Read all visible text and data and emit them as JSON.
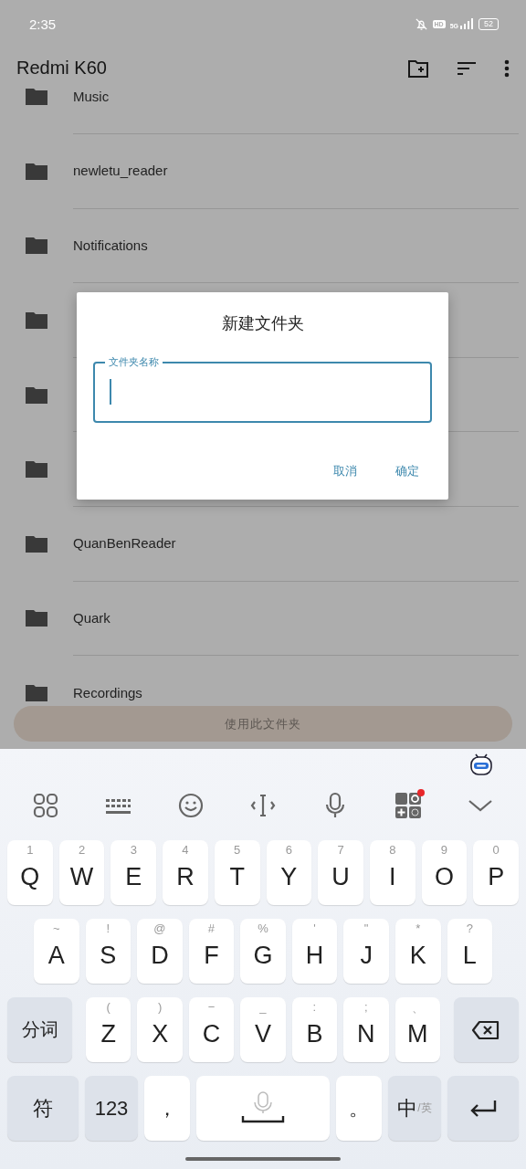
{
  "status_bar": {
    "time": "2:35",
    "muted": true,
    "hd": "HD",
    "network": "5G",
    "battery": "52"
  },
  "app_bar": {
    "title": "Redmi K60",
    "actions": [
      {
        "kind": "new-folder"
      },
      {
        "kind": "sort"
      },
      {
        "kind": "more"
      }
    ]
  },
  "folders": [
    {
      "kind": "folder",
      "label": "Music"
    },
    {
      "kind": "folder",
      "label": "newletu_reader"
    },
    {
      "kind": "folder",
      "label": "Notifications"
    },
    {
      "kind": "covered"
    },
    {
      "kind": "covered"
    },
    {
      "kind": "covered"
    },
    {
      "kind": "folder",
      "label": "QuanBenReader"
    },
    {
      "kind": "folder",
      "label": "Quark"
    },
    {
      "kind": "folder",
      "label": "Recordings"
    }
  ],
  "use_folder_button": "使用此文件夹",
  "dialog": {
    "title": "新建文件夹",
    "field": {
      "label": "文件夹名称",
      "focused": true
    },
    "buttons": [
      "取消",
      "确定"
    ]
  },
  "keyboard": {
    "toolbar": [
      {
        "kind": "apps",
        "badge": false
      },
      {
        "kind": "keyboard",
        "badge": false
      },
      {
        "kind": "emoji",
        "badge": false
      },
      {
        "kind": "cursor",
        "badge": false
      },
      {
        "kind": "mic",
        "badge": false
      },
      {
        "kind": "tools",
        "badge": true
      },
      {
        "kind": "collapse",
        "badge": false
      }
    ],
    "key_rows": [
      {
        "keys": [
          {
            "kind": "letter",
            "label": "Q",
            "hint": "1"
          },
          {
            "kind": "letter",
            "label": "W",
            "hint": "2"
          },
          {
            "kind": "letter",
            "label": "E",
            "hint": "3"
          },
          {
            "kind": "letter",
            "label": "R",
            "hint": "4"
          },
          {
            "kind": "letter",
            "label": "T",
            "hint": "5"
          },
          {
            "kind": "letter",
            "label": "Y",
            "hint": "6"
          },
          {
            "kind": "letter",
            "label": "U",
            "hint": "7"
          },
          {
            "kind": "letter",
            "label": "I",
            "hint": "8"
          },
          {
            "kind": "letter",
            "label": "O",
            "hint": "9"
          },
          {
            "kind": "letter",
            "label": "P",
            "hint": "0"
          }
        ]
      },
      {
        "keys": [
          {
            "kind": "letter",
            "label": "A",
            "hint": "~"
          },
          {
            "kind": "letter",
            "label": "S",
            "hint": "!"
          },
          {
            "kind": "letter",
            "label": "D",
            "hint": "@"
          },
          {
            "kind": "letter",
            "label": "F",
            "hint": "#"
          },
          {
            "kind": "letter",
            "label": "G",
            "hint": "%"
          },
          {
            "kind": "letter",
            "label": "H",
            "hint": "'"
          },
          {
            "kind": "letter",
            "label": "J",
            "hint": "\""
          },
          {
            "kind": "letter",
            "label": "K",
            "hint": "*"
          },
          {
            "kind": "letter",
            "label": "L",
            "hint": "?"
          }
        ]
      },
      {
        "keys": [
          {
            "kind": "func",
            "label": "分词"
          },
          {
            "kind": "letter",
            "label": "Z",
            "hint": "("
          },
          {
            "kind": "letter",
            "label": "X",
            "hint": ")"
          },
          {
            "kind": "letter",
            "label": "C",
            "hint": "−"
          },
          {
            "kind": "letter",
            "label": "V",
            "hint": "_"
          },
          {
            "kind": "letter",
            "label": "B",
            "hint": ":"
          },
          {
            "kind": "letter",
            "label": "N",
            "hint": ";"
          },
          {
            "kind": "letter",
            "label": "M",
            "hint": "、"
          },
          {
            "kind": "backspace"
          }
        ]
      },
      {
        "keys": [
          {
            "kind": "symbols",
            "label": "符"
          },
          {
            "kind": "numbers",
            "label": "123"
          },
          {
            "kind": "punct",
            "label": "，"
          },
          {
            "kind": "space"
          },
          {
            "kind": "punct",
            "label": "。"
          },
          {
            "kind": "lang",
            "label": "中",
            "sub": "/英"
          },
          {
            "kind": "enter"
          }
        ]
      }
    ]
  }
}
